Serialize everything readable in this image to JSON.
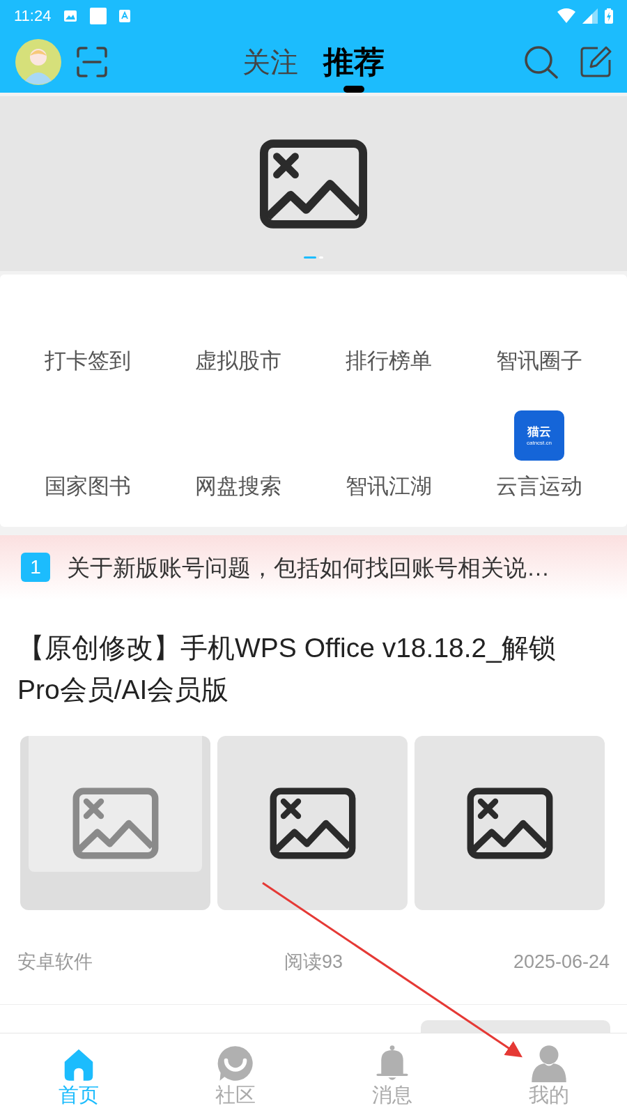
{
  "status_bar": {
    "time": "11:24"
  },
  "header": {
    "tabs": [
      {
        "label": "关注",
        "selected": false
      },
      {
        "label": "推荐",
        "selected": true
      }
    ]
  },
  "banner": {
    "kind": "picture",
    "pages": [
      {
        "selected": true
      },
      {
        "selected": false
      }
    ]
  },
  "shortcuts": [
    {
      "label": "打卡签到"
    },
    {
      "label": "虚拟股市"
    },
    {
      "label": "排行榜单"
    },
    {
      "label": "智讯圈子"
    },
    {
      "label": "国家图书"
    },
    {
      "label": "网盘搜索"
    },
    {
      "label": "智讯江湖"
    },
    {
      "label": "云言运动",
      "logo": {
        "title": "猫云",
        "subtitle": "catncst.cn"
      }
    }
  ],
  "notice": {
    "badge": "1",
    "text": "关于新版账号问题，包括如何找回账号相关说…"
  },
  "articles": [
    {
      "title": "【原创修改】手机WPS Office v18.18.2_解锁Pro会员/AI会员版",
      "images": [
        {
          "kind": "faded"
        },
        {
          "kind": "broken"
        },
        {
          "kind": "broken"
        }
      ],
      "category": "安卓软件",
      "views": "阅读93",
      "date": "2025-06-24"
    }
  ],
  "bottom_nav": [
    {
      "label": "首页",
      "selected": true
    },
    {
      "label": "社区",
      "selected": false
    },
    {
      "label": "消息",
      "selected": false
    },
    {
      "label": "我的",
      "selected": false
    }
  ]
}
